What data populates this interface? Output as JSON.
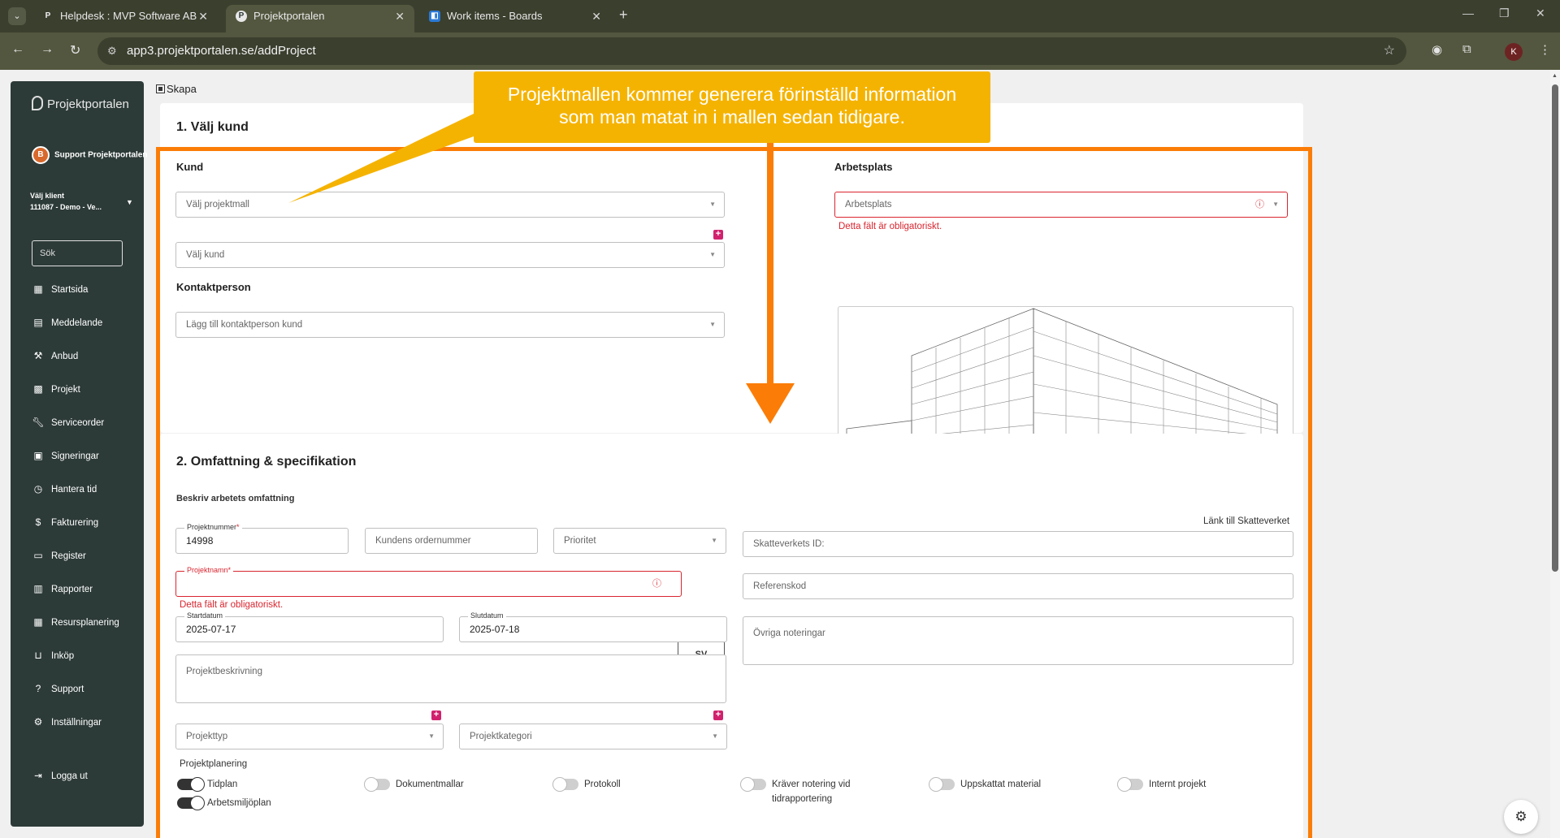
{
  "browser": {
    "tabs": [
      {
        "title": "Helpdesk : MVP Software AB",
        "icon": "p-favicon"
      },
      {
        "title": "Projektportalen",
        "icon": "projektportalen-favicon"
      },
      {
        "title": "Work items - Boards",
        "icon": "azure-boards-favicon"
      }
    ],
    "url": "app3.projektportalen.se/addProject",
    "profile_initial": "K"
  },
  "sidebar": {
    "logo": "Projektportalen",
    "user": "Support Projektportalen",
    "client_label": "Välj klient",
    "client_value": "111087 - Demo - Ve...",
    "search_placeholder": "Sök",
    "items": [
      {
        "label": "Startsida",
        "icon": "dashboard-icon"
      },
      {
        "label": "Meddelande",
        "icon": "message-icon"
      },
      {
        "label": "Anbud",
        "icon": "gavel-icon"
      },
      {
        "label": "Projekt",
        "icon": "project-icon"
      },
      {
        "label": "Serviceorder",
        "icon": "wrench-icon"
      },
      {
        "label": "Signeringar",
        "icon": "signature-icon"
      },
      {
        "label": "Hantera tid",
        "icon": "clock-icon"
      },
      {
        "label": "Fakturering",
        "icon": "dollar-icon"
      },
      {
        "label": "Register",
        "icon": "register-icon"
      },
      {
        "label": "Rapporter",
        "icon": "report-icon"
      },
      {
        "label": "Resursplanering",
        "icon": "calendar-icon"
      },
      {
        "label": "Inköp",
        "icon": "cart-icon"
      },
      {
        "label": "Support",
        "icon": "help-icon"
      },
      {
        "label": "Inställningar",
        "icon": "gear-icon"
      }
    ],
    "logout": "Logga ut"
  },
  "breadcrumb": "Skapa",
  "section1": {
    "title": "1. Välj kund",
    "kund_heading": "Kund",
    "projektmall_placeholder": "Välj projektmall",
    "kund_placeholder": "Välj kund",
    "kontakt_heading": "Kontaktperson",
    "kontakt_placeholder": "Lägg till kontaktperson kund",
    "arbetsplats_heading": "Arbetsplats",
    "arbetsplats_placeholder": "Arbetsplats",
    "arbetsplats_error": "Detta fält är obligatoriskt."
  },
  "section2": {
    "title": "2. Omfattning & specifikation",
    "subtitle": "Beskriv arbetets omfattning",
    "projektnummer_label": "Projektnummer",
    "projektnummer_value": "14998",
    "ordernummer_placeholder": "Kundens ordernummer",
    "prioritet_placeholder": "Prioritet",
    "skatteverket_link": "Länk till Skatteverket",
    "skatteverket_placeholder": "Skatteverkets ID:",
    "projektnamn_label": "Projektnamn",
    "projektnamn_error": "Detta fält är obligatoriskt.",
    "lang_button": "SV",
    "referenskod_placeholder": "Referenskod",
    "startdatum_label": "Startdatum",
    "startdatum_value": "2025-07-17",
    "slutdatum_label": "Slutdatum",
    "slutdatum_value": "2025-07-18",
    "ovriga_placeholder": "Övriga noteringar",
    "beskrivning_placeholder": "Projektbeskrivning",
    "projekttyp_placeholder": "Projekttyp",
    "projektkategori_placeholder": "Projektkategori",
    "planering_heading": "Projektplanering",
    "toggles": [
      {
        "label": "Tidplan",
        "on": true
      },
      {
        "label": "Arbetsmiljöplan",
        "on": true
      },
      {
        "label": "Dokumentmallar",
        "on": false
      },
      {
        "label": "Protokoll",
        "on": false
      },
      {
        "label": "Kräver notering vid tidrapportering",
        "on": false
      },
      {
        "label": "Uppskattat material",
        "on": false
      },
      {
        "label": "Internt projekt",
        "on": false
      }
    ]
  },
  "annotation": {
    "text_line1": "Projektmallen kommer generera förinställd information",
    "text_line2": "som man matat in i mallen sedan tidigare.",
    "color": "#f5b301",
    "box_color": "#fb7d07"
  },
  "colors": {
    "sidebar": "#2d3b38",
    "error": "#d9252f",
    "accent": "#d1216e"
  }
}
